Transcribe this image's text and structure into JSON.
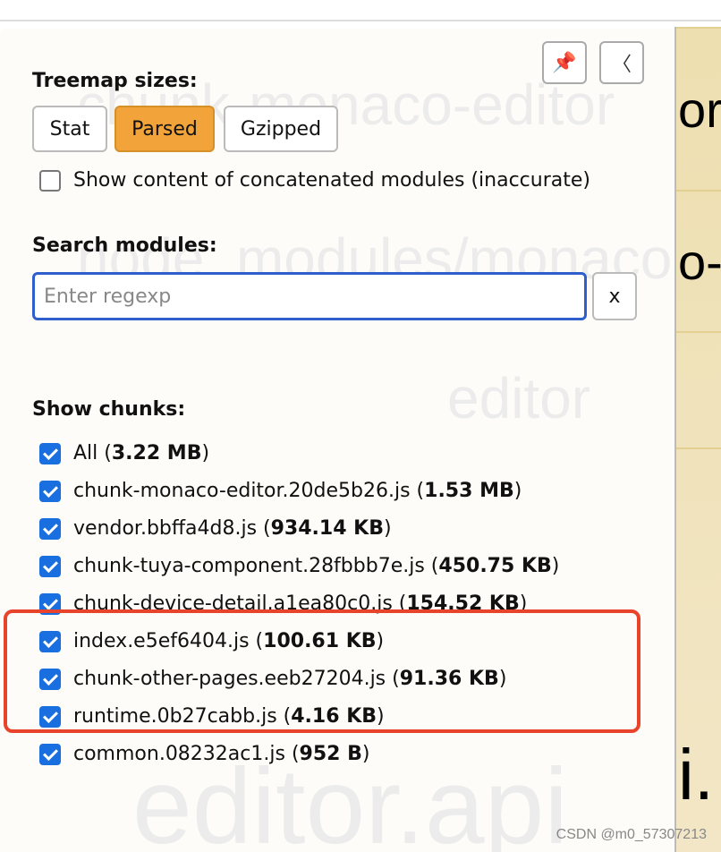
{
  "sidebar": {
    "pin_icon": "pushpin-icon",
    "collapse_icon": "chevron-left-icon",
    "treemap_sizes": {
      "title": "Treemap sizes:",
      "options": [
        "Stat",
        "Parsed",
        "Gzipped"
      ],
      "selected": "Parsed"
    },
    "concatenated": {
      "label": "Show content of concatenated modules (inaccurate)",
      "checked": false
    },
    "search": {
      "title": "Search modules:",
      "placeholder": "Enter regexp",
      "value": "",
      "clear_label": "x"
    },
    "chunks": {
      "title": "Show chunks:",
      "items": [
        {
          "name": "All",
          "size": "3.22 MB",
          "checked": true
        },
        {
          "name": "chunk-monaco-editor.20de5b26.js",
          "size": "1.53 MB",
          "checked": true
        },
        {
          "name": "vendor.bbffa4d8.js",
          "size": "934.14 KB",
          "checked": true
        },
        {
          "name": "chunk-tuya-component.28fbbb7e.js",
          "size": "450.75 KB",
          "checked": true
        },
        {
          "name": "chunk-device-detail.a1ea80c0.js",
          "size": "154.52 KB",
          "checked": true
        },
        {
          "name": "index.e5ef6404.js",
          "size": "100.61 KB",
          "checked": true
        },
        {
          "name": "chunk-other-pages.eeb27204.js",
          "size": "91.36 KB",
          "checked": true
        },
        {
          "name": "runtime.0b27cabb.js",
          "size": "4.16 KB",
          "checked": true
        },
        {
          "name": "common.08232ac1.js",
          "size": "952 B",
          "checked": true
        }
      ]
    }
  },
  "treemap_labels": [
    "chunk-monaco-editor",
    "node_modules/monaco",
    "editor",
    "editor.api"
  ],
  "treemap_visible": [
    "or",
    "o-",
    "i."
  ],
  "colors": {
    "accent": "#f2a43b",
    "checkbox": "#1a6fe0",
    "highlight": "#e8432b",
    "search_border": "#2e5fcc"
  },
  "credit": "CSDN @m0_57307213"
}
